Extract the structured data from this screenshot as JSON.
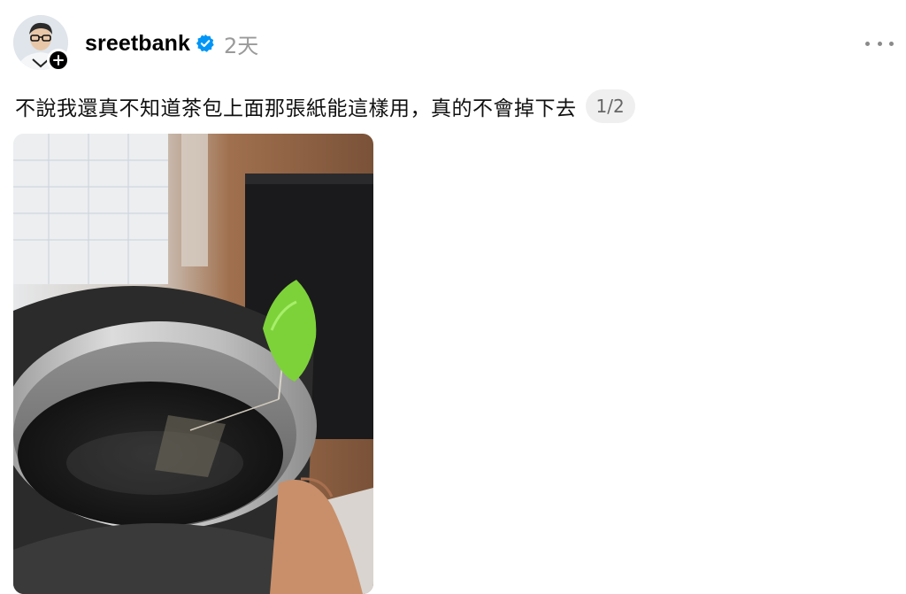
{
  "post": {
    "username": "sreetbank",
    "timestamp": "2天",
    "caption": "不說我還真不知道茶包上面那張紙能這樣用，真的不會掉下去",
    "page_indicator": "1/2",
    "icons": {
      "verified": "verified-badge-icon",
      "follow": "plus-icon",
      "more": "more-horizontal-icon"
    }
  },
  "colors": {
    "verified_blue": "#0095f6",
    "timestamp_gray": "#9a9a9a",
    "badge_bg": "#efefef"
  }
}
